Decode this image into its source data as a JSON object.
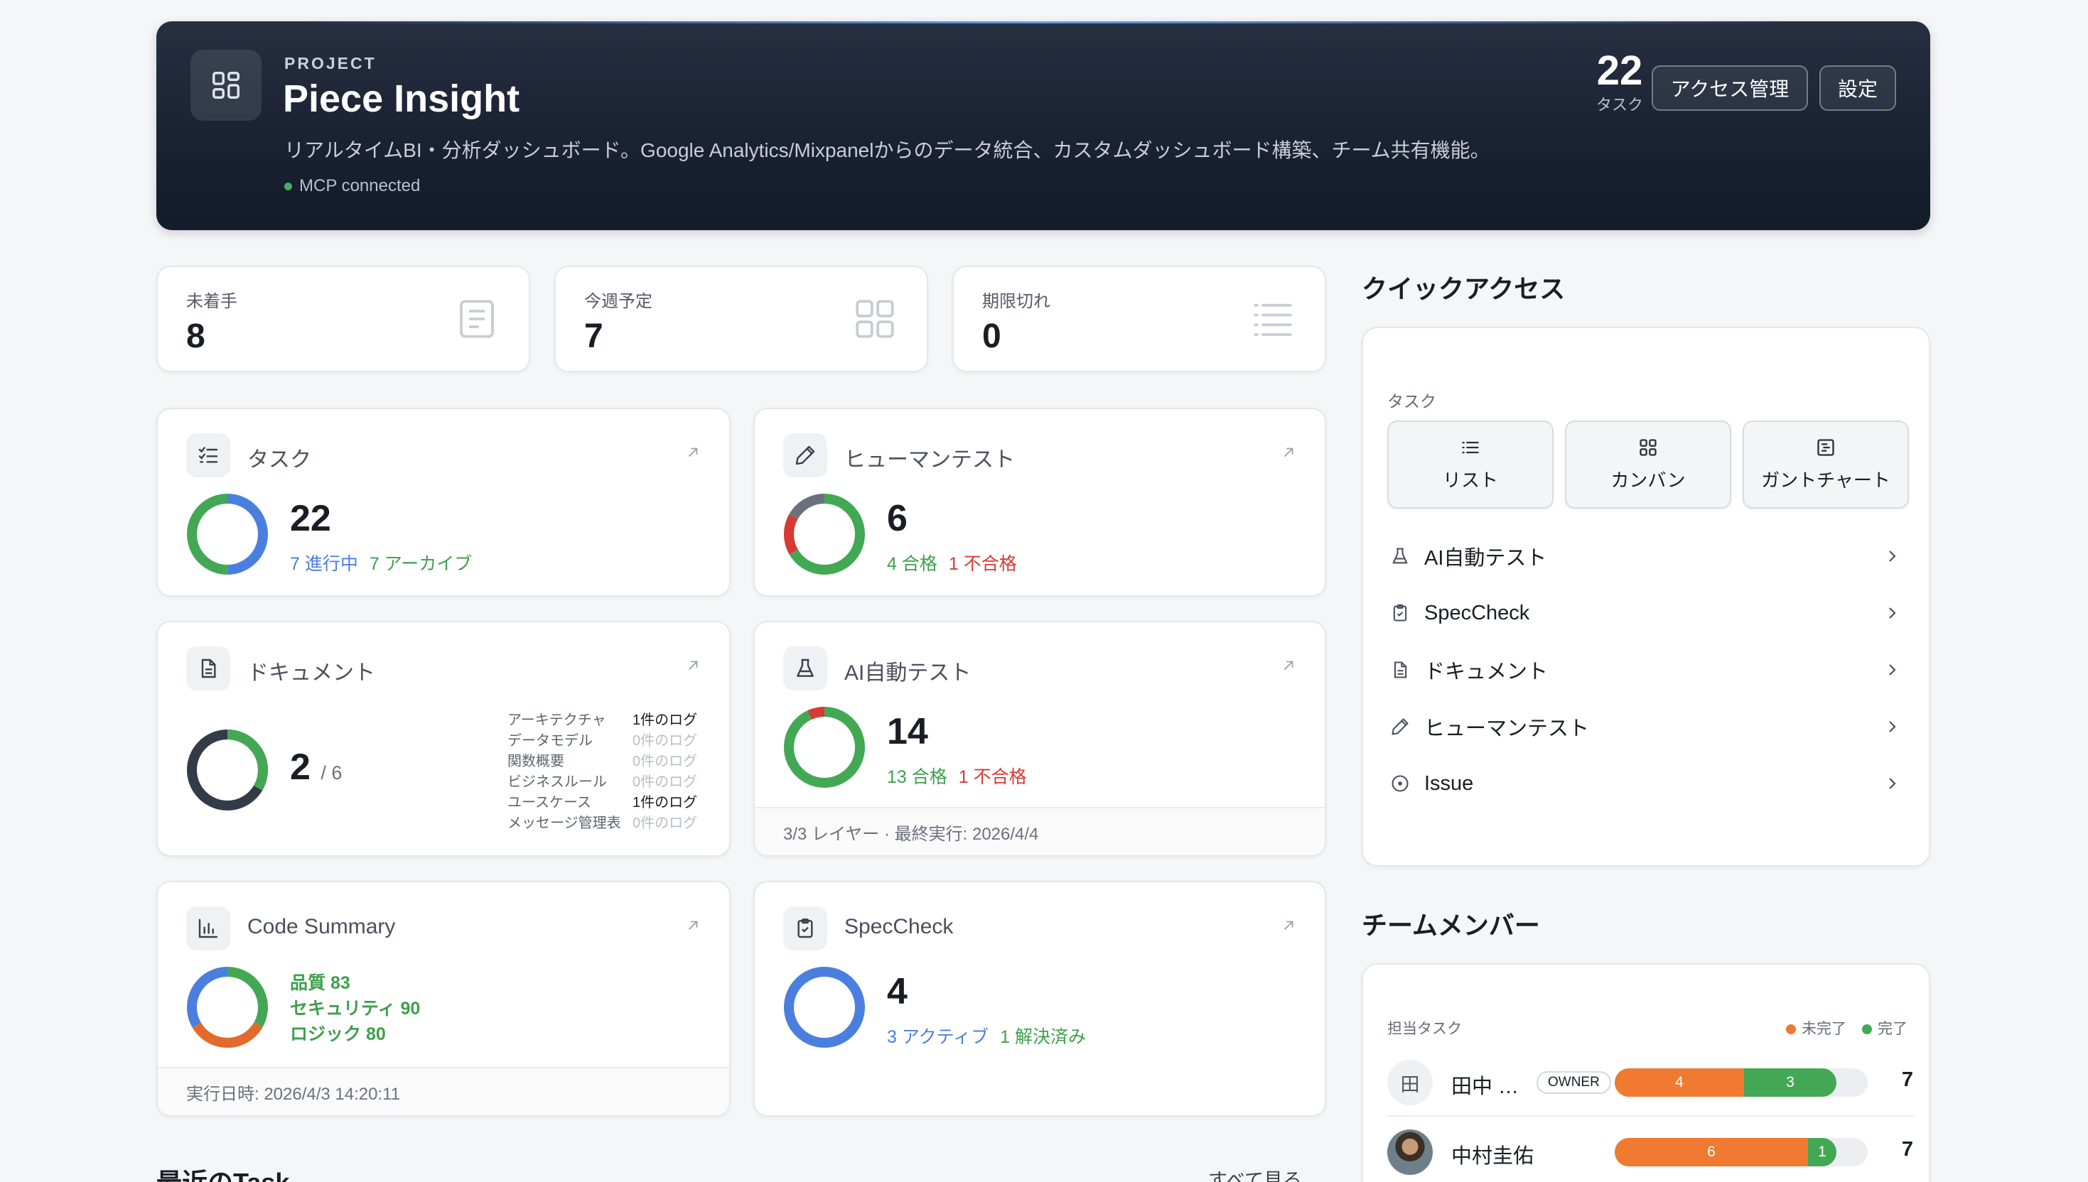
{
  "project": {
    "label": "PROJECT",
    "title": "Piece Insight",
    "description": "リアルタイムBI・分析ダッシュボード。Google Analytics/Mixpanelからのデータ統合、カスタムダッシュボード構築、チーム共有機能。",
    "status": "MCP connected",
    "task_count": "22",
    "task_count_label": "タスク",
    "access_button": "アクセス管理",
    "settings_button": "設定"
  },
  "stats": [
    {
      "label": "未着手",
      "value": "8",
      "icon": "document-icon"
    },
    {
      "label": "今週予定",
      "value": "7",
      "icon": "grid-icon"
    },
    {
      "label": "期限切れ",
      "value": "0",
      "icon": "list-icon"
    }
  ],
  "cards": {
    "tasks": {
      "title": "タスク",
      "value": "22",
      "in_progress": "7 進行中",
      "archived": "7 アーカイブ",
      "donut": {
        "progress": 0.5,
        "archive": 0.5
      }
    },
    "human_test": {
      "title": "ヒューマンテスト",
      "value": "6",
      "pass": "4 合格",
      "fail": "1 不合格",
      "donut": {
        "pass": 4,
        "fail": 1,
        "other": 1
      }
    },
    "docs": {
      "title": "ドキュメント",
      "value": "2",
      "total": "/ 6",
      "items": [
        {
          "name": "アーキテクチャ",
          "logs": "1件のログ",
          "active": true
        },
        {
          "name": "データモデル",
          "logs": "0件のログ",
          "active": false
        },
        {
          "name": "関数概要",
          "logs": "0件のログ",
          "active": false
        },
        {
          "name": "ビジネスルール",
          "logs": "0件のログ",
          "active": false
        },
        {
          "name": "ユースケース",
          "logs": "1件のログ",
          "active": true
        },
        {
          "name": "メッセージ管理表",
          "logs": "0件のログ",
          "active": false
        }
      ],
      "donut": {
        "done": 2,
        "total": 6
      }
    },
    "ai_test": {
      "title": "AI自動テスト",
      "value": "14",
      "pass": "13 合格",
      "fail": "1 不合格",
      "footer": "3/3 レイヤー · 最終実行: 2026/4/4",
      "donut": {
        "pass": 13,
        "fail": 1
      }
    },
    "code_summary": {
      "title": "Code Summary",
      "quality": "品質 83",
      "security": "セキュリティ 90",
      "logic": "ロジック 80",
      "footer": "実行日時: 2026/4/3 14:20:11",
      "donut": {
        "quality": 83,
        "security": 90,
        "logic": 80
      }
    },
    "spec_check": {
      "title": "SpecCheck",
      "value": "4",
      "active": "3 アクティブ",
      "resolved": "1 解決済み",
      "donut": {
        "active": 3,
        "resolved": 1
      }
    }
  },
  "recent": {
    "title": "最近のTask",
    "see_all": "すべて見る"
  },
  "quick_access": {
    "title": "クイックアクセス",
    "task_label": "タスク",
    "views": [
      {
        "label": "リスト",
        "icon": "list-icon"
      },
      {
        "label": "カンバン",
        "icon": "kanban-icon"
      },
      {
        "label": "ガントチャート",
        "icon": "gantt-icon"
      }
    ],
    "items": [
      {
        "label": "AI自動テスト",
        "icon": "flask-icon"
      },
      {
        "label": "SpecCheck",
        "icon": "clipboard-check-icon"
      },
      {
        "label": "ドキュメント",
        "icon": "document-icon"
      },
      {
        "label": "ヒューマンテスト",
        "icon": "pen-icon"
      },
      {
        "label": "Issue",
        "icon": "circle-dot-icon"
      }
    ]
  },
  "team": {
    "title": "チームメンバー",
    "header": "担当タスク",
    "legend_incomplete": "未完了",
    "legend_complete": "完了",
    "colors": {
      "incomplete": "#f07a30",
      "complete": "#43a854"
    },
    "members": [
      {
        "avatar": "田",
        "name": "田中 …",
        "badge": "OWNER",
        "incomplete": "4",
        "complete": "3",
        "total": "7"
      },
      {
        "avatar": "",
        "name": "中村圭佑",
        "badge": "",
        "incomplete": "6",
        "complete": "1",
        "total": "7"
      }
    ]
  }
}
